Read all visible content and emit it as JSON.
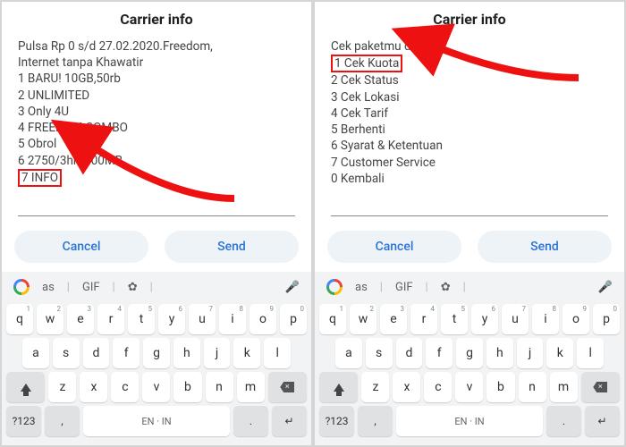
{
  "left": {
    "title": "Carrier info",
    "lines": [
      "Pulsa Rp 0 s/d 27.02.2020.Freedom,",
      "Internet tanpa Khawatir",
      "1 BARU! 10GB,50rb",
      "2 UNLIMITED",
      "3 Only 4U",
      "4 FREEDOM COMBO",
      "5 Obrol",
      "6 2750/3hr+100MB"
    ],
    "highlight": "7 INFO",
    "cancel": "Cancel",
    "send": "Send"
  },
  "right": {
    "title": "Carrier info",
    "lead": "Cek paketmu disini!",
    "highlight": "1 Cek Kuota",
    "lines": [
      "2 Cek Status",
      "3 Cek Lokasi",
      "4 Cek Tarif",
      "5 Berhenti",
      "6 Syarat & Ketentuan",
      "7 Customer Service",
      "0 Kembali"
    ],
    "cancel": "Cancel",
    "send": "Send"
  },
  "keyboard": {
    "suggest1": "as",
    "suggest2": "GIF",
    "suggest3": "✿",
    "row1": [
      "q",
      "w",
      "e",
      "r",
      "t",
      "y",
      "u",
      "i",
      "o",
      "p"
    ],
    "row1sup": [
      "1",
      "2",
      "3",
      "4",
      "5",
      "6",
      "7",
      "8",
      "9",
      "0"
    ],
    "row2": [
      "a",
      "s",
      "d",
      "f",
      "g",
      "h",
      "j",
      "k",
      "l"
    ],
    "row3": [
      "z",
      "x",
      "c",
      "v",
      "b",
      "n",
      "m"
    ],
    "sym": "?123",
    "comma": ",",
    "lang": "EN · IN",
    "period": ".",
    "enter": "↵"
  }
}
